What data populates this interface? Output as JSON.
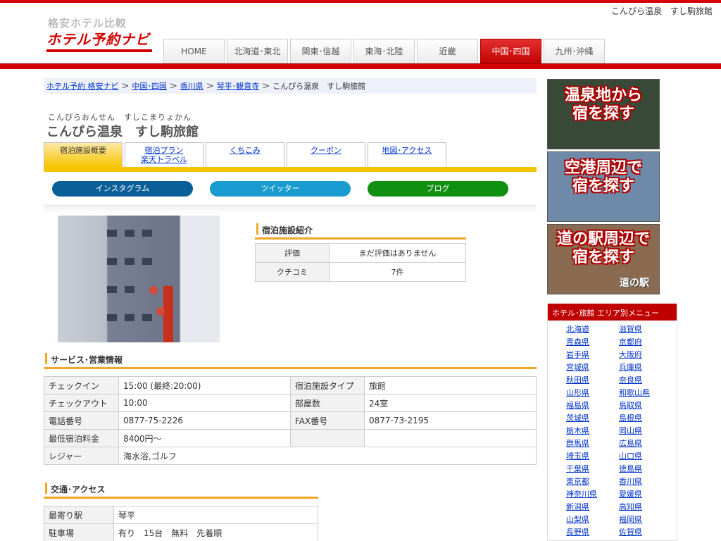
{
  "header": {
    "breadcrumb_right": "こんぴら温泉　すし駒旅館",
    "logo_sub": "格安ホテル比較",
    "logo_main": "ホテル予約ナビ",
    "nav": [
      {
        "label": "HOME"
      },
      {
        "label": "北海道･東北"
      },
      {
        "label": "関東･信越"
      },
      {
        "label": "東海･北陸"
      },
      {
        "label": "近畿"
      },
      {
        "label": "中国･四国"
      },
      {
        "label": "九州･沖縄"
      }
    ],
    "active_nav": "中国･四国"
  },
  "breadcrumb": {
    "items": [
      "ホテル予約 格安ナビ",
      "中国･四国",
      "香川県",
      "琴平･観音寺"
    ],
    "current": "こんぴら温泉　すし駒旅館"
  },
  "hotel": {
    "kana": "こんぴらおんせん　すしこまりょかん",
    "name": "こんぴら温泉　すし駒旅館"
  },
  "tabs": [
    {
      "label": "宿泊施設概要"
    },
    {
      "label": "宿泊プラン\n楽天トラベル"
    },
    {
      "label": "くちこみ"
    },
    {
      "label": "クーポン"
    },
    {
      "label": "地図･アクセス"
    }
  ],
  "social": [
    {
      "label": "インスタグラム",
      "color": "#0a5f99"
    },
    {
      "label": "ツイッター",
      "color": "#1a9bd0"
    },
    {
      "label": "ブログ",
      "color": "#109010"
    }
  ],
  "intro": {
    "heading": "宿泊施設紹介",
    "rows": [
      {
        "key": "評価",
        "value": "まだ評価はありません"
      },
      {
        "key": "クチコミ",
        "value": "7件"
      }
    ]
  },
  "service": {
    "heading": "サービス･営業情報",
    "rows": [
      [
        "チェックイン",
        "15:00 (最終:20:00)",
        "宿泊施設タイプ",
        "旅館"
      ],
      [
        "チェックアウト",
        "10:00",
        "部屋数",
        "24室"
      ],
      [
        "電話番号",
        "0877-75-2226",
        "FAX番号",
        "0877-73-2195"
      ],
      [
        "最低宿泊料金",
        "8400円〜",
        "",
        ""
      ]
    ],
    "leisure_key": "レジャー",
    "leisure_value": "海水浴,ゴルフ"
  },
  "access": {
    "heading": "交通･アクセス",
    "rows": [
      {
        "key": "最寄り駅",
        "value": "琴平"
      },
      {
        "key": "駐車場",
        "value": "有り　15台　無料　先着順"
      }
    ]
  },
  "sidebar": {
    "banners": [
      {
        "text": "温泉地から\n宿を探す",
        "bg": "#3a4a38"
      },
      {
        "text": "空港周辺で\n宿を探す",
        "bg": "#6f8aa8"
      },
      {
        "text": "道の駅周辺で\n宿を探す",
        "bg": "#8a6a50",
        "foot": "道の駅"
      }
    ],
    "area_heading": "ホテル･旅館 エリア別メニュー",
    "col1": [
      "北海道",
      "青森県",
      "岩手県",
      "宮城県",
      "秋田県",
      "山形県",
      "福島県",
      "茨城県",
      "栃木県",
      "群馬県",
      "埼玉県",
      "千葉県",
      "東京都",
      "神奈川県",
      "新潟県",
      "山梨県",
      "長野県"
    ],
    "col2": [
      "滋賀県",
      "京都府",
      "大阪府",
      "兵庫県",
      "奈良県",
      "和歌山県",
      "鳥取県",
      "島根県",
      "岡山県",
      "広島県",
      "山口県",
      "徳島県",
      "香川県",
      "愛媛県",
      "高知県",
      "福岡県",
      "佐賀県"
    ]
  }
}
